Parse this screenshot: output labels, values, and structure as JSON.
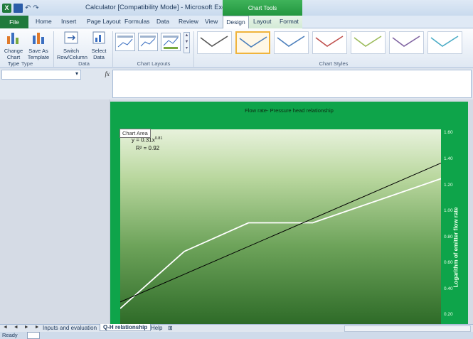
{
  "titlebar": {
    "title": "Calculator [Compatibility Mode] - Microsoft Excel",
    "context_label": "Chart Tools",
    "qat_logo": "X"
  },
  "tabs": [
    "File",
    "Home",
    "Insert",
    "Page Layout",
    "Formulas",
    "Data",
    "Review",
    "View",
    "Design",
    "Layout",
    "Format"
  ],
  "ribbon": {
    "type_group": {
      "label": "Type",
      "change_chart_type": "Change Chart Type",
      "save_as_template": "Save As Template"
    },
    "data_group": {
      "label": "Data",
      "switch_row_column": "Switch Row/Column",
      "select_data": "Select Data"
    },
    "layouts_group": {
      "label": "Chart Layouts"
    },
    "styles_group": {
      "label": "Chart Styles",
      "style_colors": [
        "#555555",
        "#4a7ebb",
        "#4a7ebb",
        "#c0504d",
        "#9bbb59",
        "#8064a2",
        "#4bacc6"
      ]
    }
  },
  "formula_bar": {
    "namebox_value": "",
    "fx_label": "fx",
    "formula": ""
  },
  "chart": {
    "title": "Flow rate- Pressure head relationship",
    "tooltip": "Chart Area",
    "equation": "y = 0.31x",
    "equation_exp": "0.81",
    "r_squared": "R² = 0.92",
    "y_axis_label": "Logarithm of emitter flow rate",
    "y_ticks": [
      "1.60",
      "1.40",
      "1.20",
      "1.00",
      "0.80",
      "0.60",
      "0.40",
      "0.20"
    ]
  },
  "chart_data": {
    "type": "line",
    "title": "Flow rate- Pressure head relationship",
    "ylabel": "Logarithm of emitter flow rate",
    "ylim": [
      0.13,
      1.63
    ],
    "series": [
      {
        "name": "",
        "type": "line",
        "x": [
          0.0,
          0.2,
          0.4,
          0.6,
          0.8,
          1.0
        ],
        "y": [
          0.25,
          0.69,
          0.91,
          0.91,
          1.08,
          1.25
        ],
        "color": "#ffffff"
      },
      {
        "name": "",
        "type": "trendline",
        "x": [
          0.0,
          1.0
        ],
        "y": [
          0.3,
          1.37
        ],
        "color": "#000000"
      }
    ]
  },
  "sheet_tabs": {
    "tab1": "Inputs and evaluation",
    "tab2": "Q-H relationship",
    "tab3": "Help",
    "nav": "◄ ◄ ► ►"
  },
  "status": {
    "text": "Ready"
  }
}
